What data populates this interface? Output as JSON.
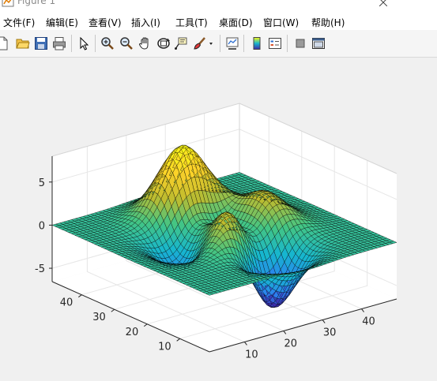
{
  "window": {
    "title": "Figure 1",
    "app_icon": "matlab-figure-icon"
  },
  "menu": [
    {
      "label": "文件(F)"
    },
    {
      "label": "编辑(E)"
    },
    {
      "label": "查看(V)"
    },
    {
      "label": "插入(I)"
    },
    {
      "label": "工具(T)"
    },
    {
      "label": "桌面(D)"
    },
    {
      "label": "窗口(W)"
    },
    {
      "label": "帮助(H)"
    }
  ],
  "toolbar": {
    "buttons": [
      "new-figure-icon",
      "open-file-icon",
      "save-icon",
      "print-icon",
      "select-arrow-icon",
      "zoom-in-icon",
      "zoom-out-icon",
      "pan-hand-icon",
      "rotate-3d-icon",
      "data-cursor-icon",
      "brush-icon",
      "brush-dropdown-icon",
      "link-plot-icon",
      "colorbar-icon",
      "legend-icon",
      "hide-plot-tools-icon",
      "show-plot-tools-icon"
    ]
  },
  "colors": {
    "colormap": [
      "#3e26a8",
      "#2d7ff0",
      "#16b6cf",
      "#43c584",
      "#bfbc2e",
      "#fcd12a",
      "#f9fb15"
    ],
    "axes_background": "#ffffff",
    "figure_background": "#f0f0f0"
  },
  "chart_data": {
    "type": "surface",
    "function": "peaks",
    "grid_size": 49,
    "x_ticks": [
      10,
      20,
      30,
      40
    ],
    "y_ticks": [
      10,
      20,
      30,
      40
    ],
    "z_ticks": [
      -5,
      0,
      5
    ],
    "xlim": [
      1,
      49
    ],
    "ylim": [
      1,
      49
    ],
    "zlim": [
      -6.55,
      8
    ],
    "z_max": 8.0,
    "z_min": -6.55,
    "view": {
      "azimuth": -37.5,
      "elevation": 30
    },
    "grid": true,
    "colormap": "parula",
    "edge_color": "#000000"
  }
}
